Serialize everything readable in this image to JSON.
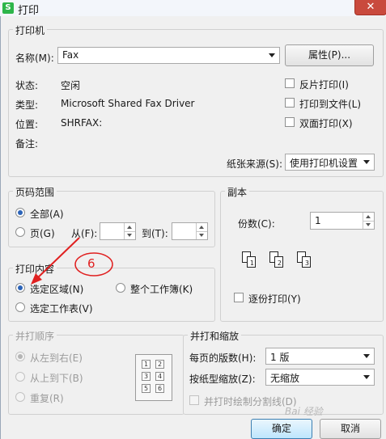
{
  "window": {
    "title": "打印",
    "app_icon_letter": "S",
    "close_symbol": "✕"
  },
  "printer": {
    "legend": "打印机",
    "name_label": "名称(M):",
    "name_value": "Fax",
    "properties_button": "属性(P)...",
    "status_label": "状态:",
    "status_value": "空闲",
    "type_label": "类型:",
    "type_value": "Microsoft Shared Fax Driver",
    "location_label": "位置:",
    "location_value": "SHRFAX:",
    "comment_label": "备注:",
    "print_reverse": "反片打印(I)",
    "print_to_file": "打印到文件(L)",
    "duplex": "双面打印(X)",
    "paper_source_label": "纸张来源(S):",
    "paper_source_value": "使用打印机设置"
  },
  "page_range": {
    "legend": "页码范围",
    "all_label": "全部(A)",
    "pages_label": "页(G)",
    "from_label": "从(F):",
    "to_label": "到(T):",
    "selected": "all"
  },
  "copies": {
    "legend": "副本",
    "count_label": "份数(C):",
    "count_value": "1",
    "collate_label": "逐份打印(Y)",
    "collate_pages": [
      "1",
      "2",
      "3"
    ]
  },
  "print_content": {
    "legend": "打印内容",
    "selection_label": "选定区域(N)",
    "whole_workbook_label": "整个工作簿(K)",
    "selected_sheets_label": "选定工作表(V)",
    "selected": "selection"
  },
  "annotation": {
    "number": "6"
  },
  "collate_order": {
    "legend": "并打顺序",
    "left_to_right": "从左到右(E)",
    "top_to_bottom": "从上到下(B)",
    "repeat": "重复(R)",
    "preview_cells": [
      "1",
      "2",
      "3",
      "4",
      "5",
      "6"
    ]
  },
  "zoom": {
    "legend": "并打和缩放",
    "pages_per_sheet_label": "每页的版数(H):",
    "pages_per_sheet_value": "1 版",
    "scale_to_paper_label": "按纸型缩放(Z):",
    "scale_to_paper_value": "无缩放",
    "draw_dividers_label": "并打时绘制分割线(D)"
  },
  "footer": {
    "ok": "确定",
    "cancel": "取消"
  },
  "watermark": {
    "text": "Bai 经验"
  },
  "colors": {
    "annotation_red": "#e02020",
    "close_red": "#c94a3d",
    "accent_blue": "#2b63b8"
  }
}
